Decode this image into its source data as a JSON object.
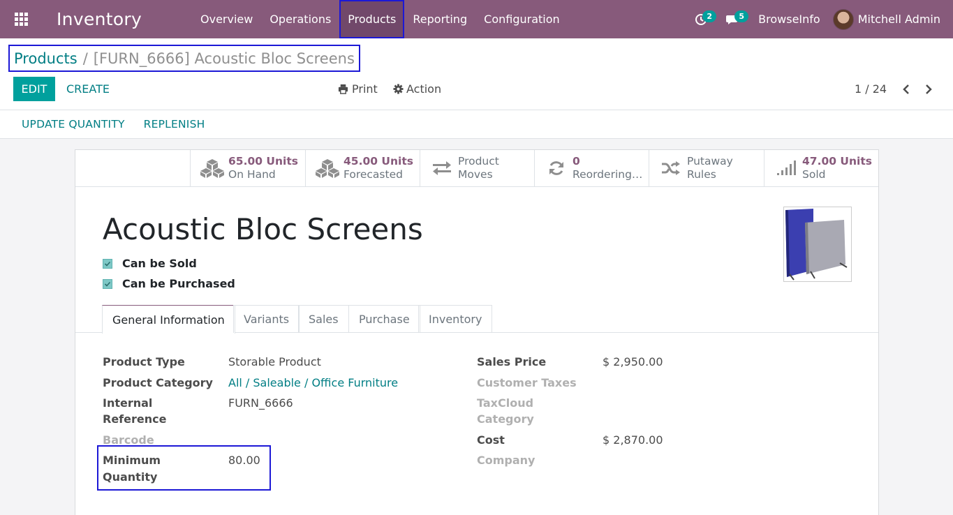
{
  "navbar": {
    "app_title": "Inventory",
    "menu": [
      "Overview",
      "Operations",
      "Products",
      "Reporting",
      "Configuration"
    ],
    "activity_count": "2",
    "messages_count": "5",
    "company": "BrowseInfo",
    "user": "Mitchell Admin"
  },
  "breadcrumb": {
    "parent": "Products",
    "separator": "/",
    "current": "[FURN_6666] Acoustic Bloc Screens"
  },
  "buttons": {
    "edit": "EDIT",
    "create": "CREATE",
    "print": "Print",
    "action": "Action",
    "update_quantity": "UPDATE QUANTITY",
    "replenish": "REPLENISH"
  },
  "pager": {
    "value": "1 / 24"
  },
  "smart_buttons": [
    {
      "value": "65.00 Units",
      "label": "On Hand",
      "icon": "cubes-icon"
    },
    {
      "value": "45.00 Units",
      "label": "Forecasted",
      "icon": "cubes-icon"
    },
    {
      "value": "Product",
      "label": "Moves",
      "icon": "exchange-icon"
    },
    {
      "value": "0",
      "label": "Reordering…",
      "icon": "refresh-icon"
    },
    {
      "value": "Putaway",
      "label": "Rules",
      "icon": "random-icon"
    },
    {
      "value": "47.00 Units",
      "label": "Sold",
      "icon": "signal-icon"
    }
  ],
  "product": {
    "name": "Acoustic Bloc Screens",
    "can_be_sold": "Can be Sold",
    "can_be_purchased": "Can be Purchased"
  },
  "tabs": [
    "General Information",
    "Variants",
    "Sales",
    "Purchase",
    "Inventory"
  ],
  "left_fields": {
    "product_type_label": "Product Type",
    "product_type_value": "Storable Product",
    "category_label": "Product Category",
    "category_value": "All / Saleable / Office Furniture",
    "internal_ref_label_1": "Internal",
    "internal_ref_label_2": "Reference",
    "internal_ref_value": "FURN_6666",
    "barcode_label": "Barcode",
    "min_qty_label_1": "Minimum",
    "min_qty_label_2": "Quantity",
    "min_qty_value": "80.00"
  },
  "right_fields": {
    "sales_price_label": "Sales Price",
    "sales_price_value": "$ 2,950.00",
    "customer_taxes_label": "Customer Taxes",
    "taxcloud_label_1": "TaxCloud",
    "taxcloud_label_2": "Category",
    "cost_label": "Cost",
    "cost_value": "$ 2,870.00",
    "company_label": "Company"
  },
  "colors": {
    "navbar": "#875a7b",
    "primary": "#00a09d",
    "link": "#017e84",
    "highlight": "#1c18d6"
  }
}
